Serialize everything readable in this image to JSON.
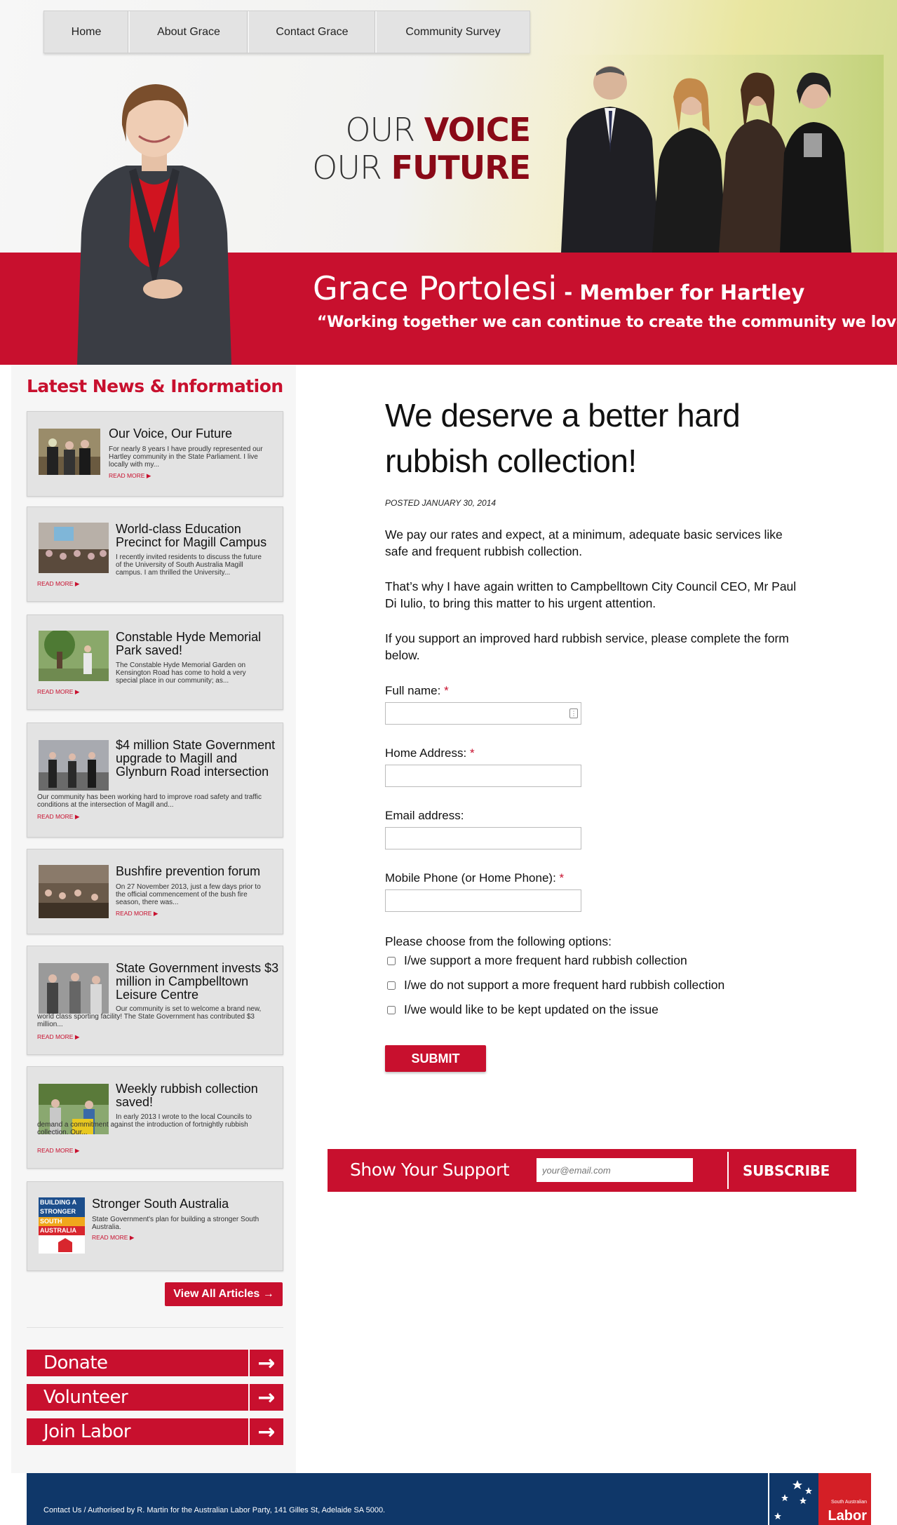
{
  "nav": {
    "items": [
      "Home",
      "About Grace",
      "Contact Grace",
      "Community Survey"
    ]
  },
  "hero": {
    "slogan_line1_light": "OUR ",
    "slogan_line1_bold": "VOICE",
    "slogan_line2_light": "OUR ",
    "slogan_line2_bold": "FUTURE",
    "name": "Grace Portolesi",
    "role": " - Member for Hartley",
    "quote": "“Working together we can continue to create the community we love!”"
  },
  "sidebar": {
    "heading": "Latest News & Information",
    "news": [
      {
        "title": "Our Voice, Our Future",
        "excerpt": "For nearly 8 years I have proudly represented our Hartley community in the State Parliament. I live locally with my...",
        "read_more": "READ MORE ▶"
      },
      {
        "title": "World-class Education Precinct for Magill Campus",
        "excerpt": "I recently invited residents to discuss the future of the University of South Australia Magill campus. I am thrilled the University...",
        "read_more": "READ MORE ▶"
      },
      {
        "title": "Constable Hyde Memorial Park saved!",
        "excerpt": "The Constable Hyde Memorial Garden on Kensington Road has come to hold a very special place in our community; as...",
        "read_more": "READ MORE ▶"
      },
      {
        "title": "$4 million State Government upgrade to Magill and Glynburn Road intersection",
        "excerpt": "Our community has been working hard to improve road safety and traffic conditions at the intersection of Magill and...",
        "read_more": "READ MORE ▶"
      },
      {
        "title": "Bushfire prevention forum",
        "excerpt": "On 27 November 2013, just a few days prior to the official commencement of the bush fire season, there was...",
        "read_more": "READ MORE ▶"
      },
      {
        "title": "State Government invests $3 million in Campbelltown Leisure Centre",
        "excerpt": "Our community is set to welcome a brand new, world class sporting facility! The State Government has contributed $3 million...",
        "read_more": "READ MORE ▶"
      },
      {
        "title": "Weekly rubbish collection saved!",
        "excerpt": "In early 2013 I wrote to the local Councils to demand a commitment against the introduction of fortnightly rubbish collection. Our...",
        "read_more": "READ MORE ▶"
      },
      {
        "title": "Stronger South Australia",
        "excerpt": "State Government's plan for building a stronger South Australia.",
        "read_more": "READ MORE ▶",
        "logo_lines": [
          "BUILDING A",
          "STRONGER",
          "SOUTH",
          "AUSTRALIA"
        ]
      }
    ],
    "view_all": "View All Articles →",
    "actions": [
      "Donate",
      "Volunteer",
      "Join Labor"
    ]
  },
  "post": {
    "title": "We deserve a better hard rubbish collection!",
    "posted": "POSTED JANUARY 30, 2014",
    "paragraphs": [
      "We pay our rates and expect, at a minimum, adequate basic services like safe and frequent rubbish collection.",
      "That’s why I have again written to Campbelltown City Council CEO, Mr Paul Di Iulio, to bring this matter to his urgent attention.",
      "If you support an improved hard rubbish service, please complete the form below."
    ],
    "form": {
      "full_name_label": "Full name:",
      "address_label": "Home Address:",
      "email_label": "Email address:",
      "phone_label": "Mobile Phone (or Home Phone):",
      "required_mark": "*",
      "options_label": "Please choose from the following options:",
      "options": [
        "I/we support a more frequent hard rubbish collection",
        "I/we do not support a more frequent hard rubbish collection",
        "I/we would like to be kept updated on the issue"
      ],
      "submit": "SUBMIT"
    }
  },
  "support": {
    "title": "Show Your Support",
    "email_placeholder": "your@email.com",
    "subscribe": "SUBSCRIBE"
  },
  "footer": {
    "text": "Contact Us / Authorised by R. Martin for the Australian Labor Party, 141 Gilles St, Adelaide SA 5000.",
    "logo_small": "South Australian",
    "logo_word": "Labor"
  },
  "colors": {
    "brand_red": "#c8102e",
    "dark_red": "#8a0a17",
    "navy": "#0f3769"
  }
}
